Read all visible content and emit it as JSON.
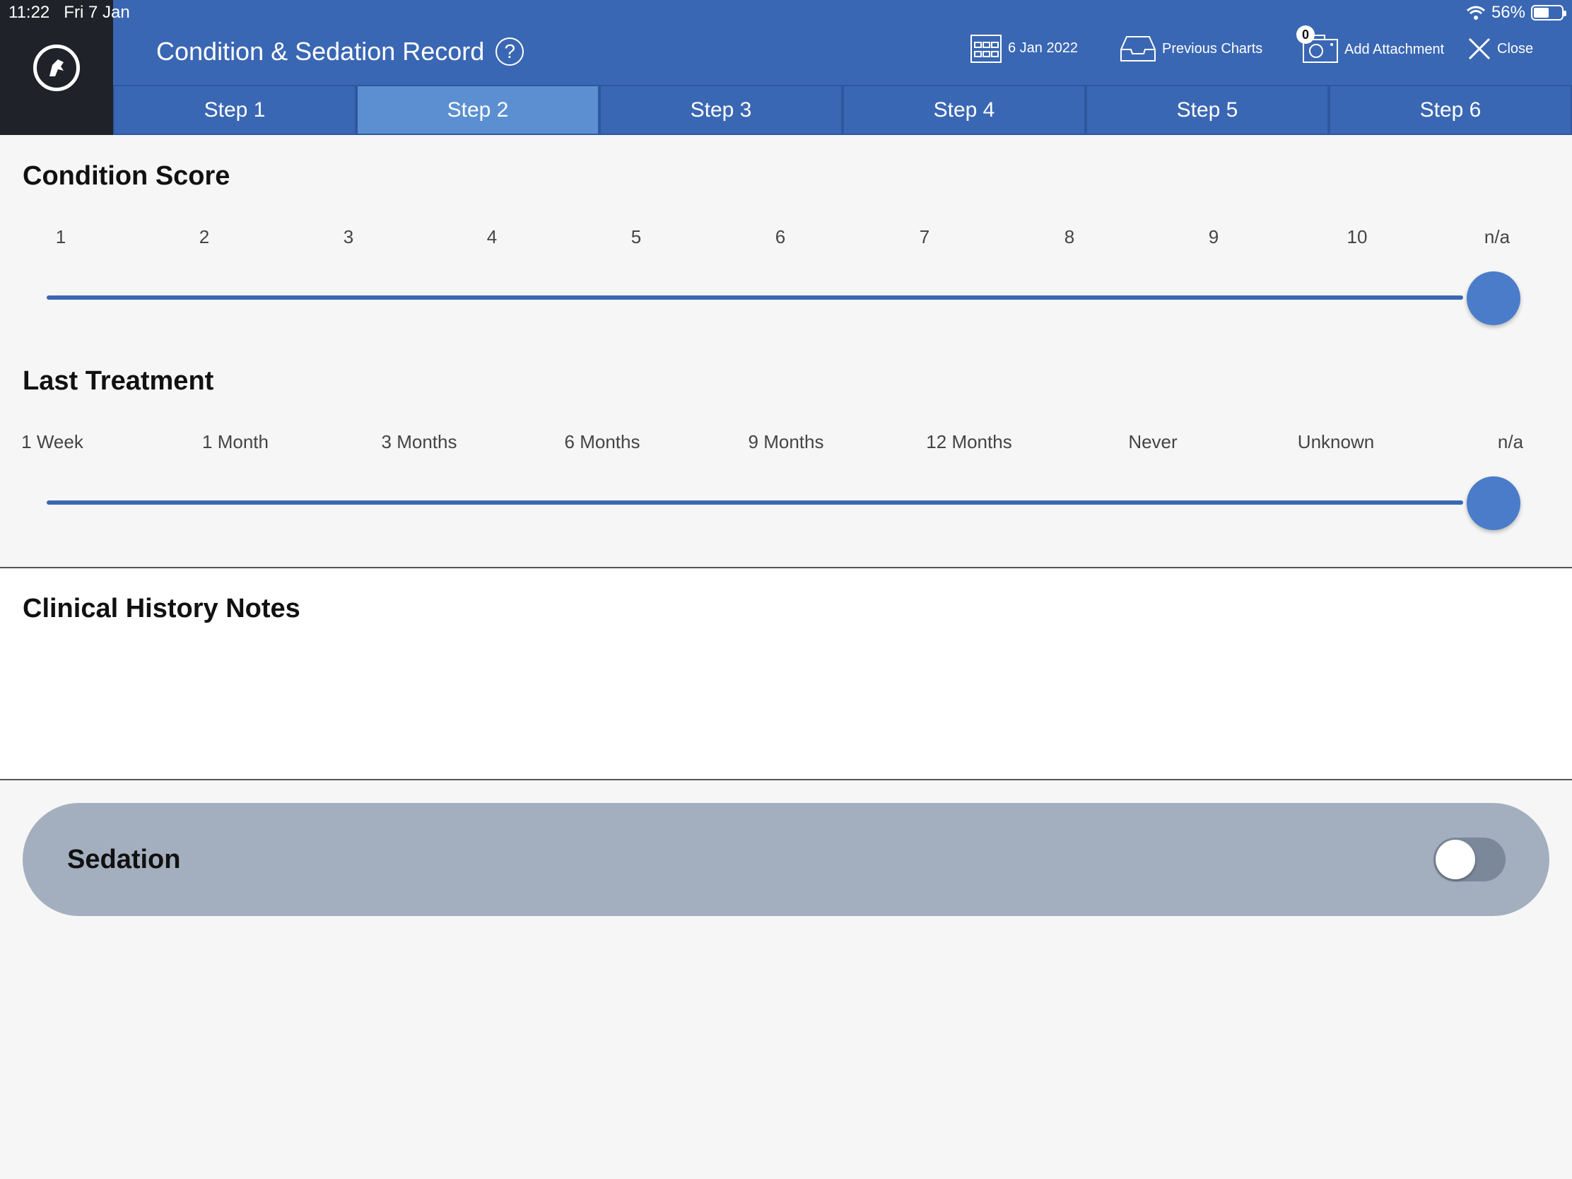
{
  "status_bar": {
    "time": "11:22",
    "date": "Fri 7 Jan",
    "battery": "56%",
    "battery_level": 0.56
  },
  "header": {
    "title": "Condition & Sedation Record",
    "help_symbol": "?",
    "date_label": "6 Jan 2022",
    "previous_charts_label": "Previous Charts",
    "attachment_count": "0",
    "add_attachment_label": "Add Attachment",
    "close_label": "Close"
  },
  "tabs": [
    "Step 1",
    "Step 2",
    "Step 3",
    "Step 4",
    "Step 5",
    "Step 6"
  ],
  "active_tab_index": 1,
  "condition_score": {
    "title": "Condition Score",
    "options": [
      "1",
      "2",
      "3",
      "4",
      "5",
      "6",
      "7",
      "8",
      "9",
      "10",
      "n/a"
    ],
    "selected": "n/a"
  },
  "last_treatment": {
    "title": "Last Treatment",
    "options": [
      "1 Week",
      "1 Month",
      "3 Months",
      "6 Months",
      "9 Months",
      "12 Months",
      "Never",
      "Unknown",
      "n/a"
    ],
    "selected": "n/a"
  },
  "clinical_notes": {
    "title": "Clinical History Notes",
    "value": ""
  },
  "sedation": {
    "label": "Sedation",
    "enabled": false
  },
  "colors": {
    "header": "#3a67b3",
    "tab_active": "#5b8fd1",
    "logo_bg": "#1f2329",
    "slider": "#3a67b3",
    "sedation_bg": "#a3afbe"
  }
}
